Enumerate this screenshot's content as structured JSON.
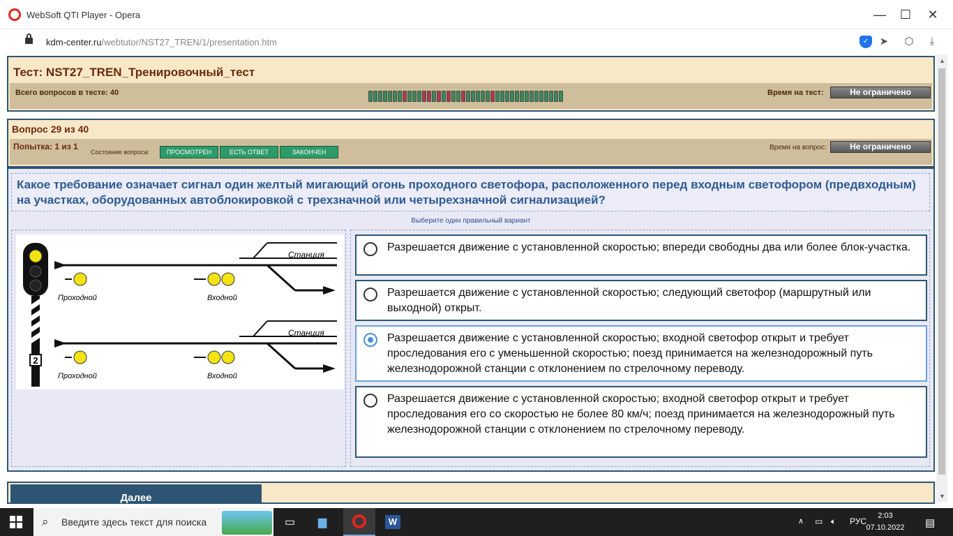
{
  "window": {
    "title": "WebSoft QTI Player - Opera",
    "minimize": "—",
    "maximize": "☐",
    "close": "✕"
  },
  "address": {
    "host": "kdm-center.ru",
    "path": "/webtutor/NST27_TREN/1/presentation.htm"
  },
  "test": {
    "title": "Тест: NST27_TREN_Тренировочный_тест",
    "total_label": "Всего вопросов в тесте: 40",
    "time_label": "Время на тест:",
    "time_value": "Не ограничено",
    "progress": [
      "g",
      "g",
      "g",
      "g",
      "g",
      "g",
      "g",
      "r",
      "g",
      "g",
      "g",
      "r",
      "r",
      "g",
      "r",
      "g",
      "r",
      "g",
      "g",
      "r",
      "g",
      "g",
      "g",
      "g",
      "g",
      "r",
      "g",
      "g",
      "g",
      "g",
      "g",
      "g",
      "g",
      "g",
      "g",
      "g",
      "g",
      "g",
      "g",
      "g"
    ]
  },
  "question": {
    "header": "Вопрос 29 из 40",
    "attempt": "Попытка: 1 из 1",
    "state_label": "Состояние вопроса:",
    "states": [
      "ПРОСМОТРЕН",
      "ЕСТЬ ОТВЕТ",
      "ЗАКОНЧЕН"
    ],
    "time_label": "Время на вопрос:",
    "time_value": "Не ограничено",
    "text": "Какое требование означает сигнал один желтый мигающий огонь проходного светофора, расположенного перед входным светофором (предвходным) на участках, оборудованных автоблокировкой с трехзначной или четырехзначной сигнализацией?",
    "hint": "Выберите один правильный вариант",
    "options": [
      {
        "text": "Разрешается движение с установленной скоростью; впереди свободны два или более блок-участка.",
        "selected": false
      },
      {
        "text": "Разрешается движение с установленной скоростью; следующий светофор (маршрутный или выходной) открыт.",
        "selected": false
      },
      {
        "text": "Разрешается движение с установленной скоростью; входной светофор открыт и требует проследования его с уменьшенной скоростью; поезд принимается на железнодорожный путь железнодорожной станции с отклонением по стрелочному переводу.",
        "selected": true
      },
      {
        "text": "Разрешается движение с установленной скоростью; входной светофор открыт и требует проследования его со скоростью не более 80 км/ч; поезд принимается на железнодорожный путь железнодорожной станции с отклонением по стрелочному переводу.",
        "selected": false
      }
    ]
  },
  "diagram": {
    "station": "Станция",
    "prokhodnoy": "Проходной",
    "vkhodnoy": "Входной",
    "post_number": "2"
  },
  "footer": {
    "next": "Далее"
  },
  "taskbar": {
    "search_placeholder": "Введите здесь текст для поиска",
    "lang": "РУС",
    "time": "2:03",
    "date": "07.10.2022"
  }
}
